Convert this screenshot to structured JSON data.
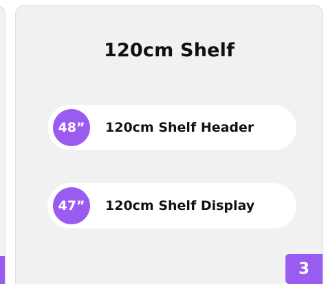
{
  "card": {
    "title": "120cm Shelf",
    "items": [
      {
        "size": "48”",
        "label": "120cm Shelf Header"
      },
      {
        "size": "47”",
        "label": "120cm Shelf Display"
      }
    ],
    "page_number": "3"
  },
  "colors": {
    "accent": "#9a5cf0",
    "card_background": "#f1f1f1",
    "item_background": "#ffffff",
    "text": "#111111"
  }
}
